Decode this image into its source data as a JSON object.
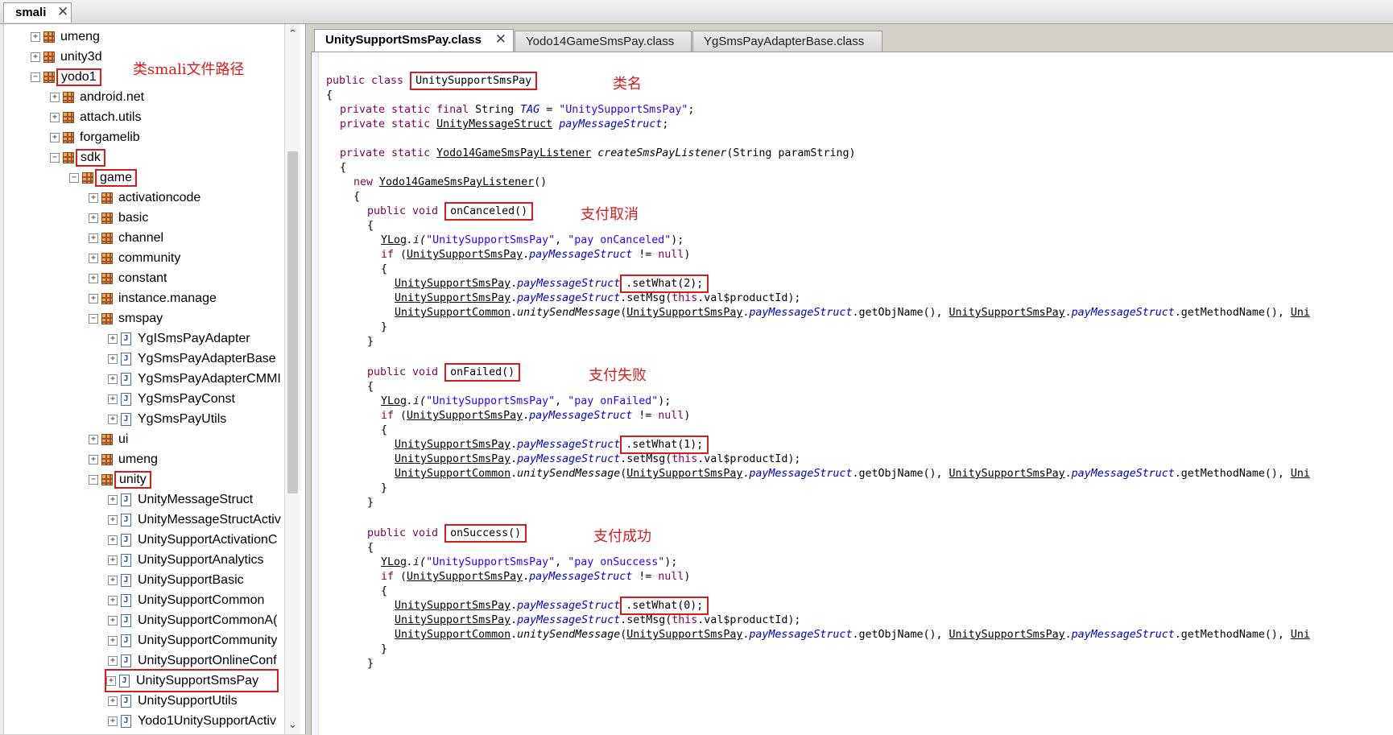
{
  "root_tab": {
    "label": "smali",
    "close": "✕"
  },
  "tree": {
    "annotation": "类smali文件路径",
    "items": [
      {
        "label": "umeng",
        "type": "pkg",
        "depth": 1,
        "expand": "+"
      },
      {
        "label": "unity3d",
        "type": "pkg",
        "depth": 1,
        "expand": "+"
      },
      {
        "label": "yodo1",
        "type": "pkg",
        "depth": 1,
        "expand": "−",
        "boxed": true
      },
      {
        "label": "android.net",
        "type": "pkg",
        "depth": 2,
        "expand": "+"
      },
      {
        "label": "attach.utils",
        "type": "pkg",
        "depth": 2,
        "expand": "+"
      },
      {
        "label": "forgamelib",
        "type": "pkg",
        "depth": 2,
        "expand": "+"
      },
      {
        "label": "sdk",
        "type": "pkg",
        "depth": 2,
        "expand": "−",
        "boxed": true
      },
      {
        "label": "game",
        "type": "pkg",
        "depth": 3,
        "expand": "−",
        "boxed": true
      },
      {
        "label": "activationcode",
        "type": "pkg",
        "depth": 4,
        "expand": "+"
      },
      {
        "label": "basic",
        "type": "pkg",
        "depth": 4,
        "expand": "+"
      },
      {
        "label": "channel",
        "type": "pkg",
        "depth": 4,
        "expand": "+"
      },
      {
        "label": "community",
        "type": "pkg",
        "depth": 4,
        "expand": "+"
      },
      {
        "label": "constant",
        "type": "pkg",
        "depth": 4,
        "expand": "+"
      },
      {
        "label": "instance.manage",
        "type": "pkg",
        "depth": 4,
        "expand": "+"
      },
      {
        "label": "smspay",
        "type": "pkg",
        "depth": 4,
        "expand": "−"
      },
      {
        "label": "YgISmsPayAdapter",
        "type": "cls",
        "depth": 5,
        "expand": "+"
      },
      {
        "label": "YgSmsPayAdapterBase",
        "type": "cls",
        "depth": 5,
        "expand": "+"
      },
      {
        "label": "YgSmsPayAdapterCMMI",
        "type": "cls",
        "depth": 5,
        "expand": "+"
      },
      {
        "label": "YgSmsPayConst",
        "type": "cls",
        "depth": 5,
        "expand": "+"
      },
      {
        "label": "YgSmsPayUtils",
        "type": "cls",
        "depth": 5,
        "expand": "+"
      },
      {
        "label": "ui",
        "type": "pkg",
        "depth": 4,
        "expand": "+"
      },
      {
        "label": "umeng",
        "type": "pkg",
        "depth": 4,
        "expand": "+"
      },
      {
        "label": "unity",
        "type": "pkg",
        "depth": 4,
        "expand": "−",
        "boxed": true
      },
      {
        "label": "UnityMessageStruct",
        "type": "cls",
        "depth": 5,
        "expand": "+"
      },
      {
        "label": "UnityMessageStructActiv",
        "type": "cls",
        "depth": 5,
        "expand": "+"
      },
      {
        "label": "UnitySupportActivationC",
        "type": "cls",
        "depth": 5,
        "expand": "+"
      },
      {
        "label": "UnitySupportAnalytics",
        "type": "cls",
        "depth": 5,
        "expand": "+"
      },
      {
        "label": "UnitySupportBasic",
        "type": "cls",
        "depth": 5,
        "expand": "+"
      },
      {
        "label": "UnitySupportCommon",
        "type": "cls",
        "depth": 5,
        "expand": "+"
      },
      {
        "label": "UnitySupportCommonA(",
        "type": "cls",
        "depth": 5,
        "expand": "+"
      },
      {
        "label": "UnitySupportCommunity",
        "type": "cls",
        "depth": 5,
        "expand": "+"
      },
      {
        "label": "UnitySupportOnlineConf",
        "type": "cls",
        "depth": 5,
        "expand": "+"
      },
      {
        "label": "UnitySupportSmsPay",
        "type": "cls",
        "depth": 5,
        "expand": "+",
        "boxed_full": true
      },
      {
        "label": "UnitySupportUtils",
        "type": "cls",
        "depth": 5,
        "expand": "+"
      },
      {
        "label": "Yodo1UnitySupportActiv",
        "type": "cls",
        "depth": 5,
        "expand": "+"
      }
    ],
    "scroll_up": "⌃",
    "scroll_down": "⌄"
  },
  "editor_tabs": [
    {
      "label": "UnitySupportSmsPay.class",
      "active": true,
      "close": "✕"
    },
    {
      "label": "Yodo14GameSmsPay.class",
      "active": false
    },
    {
      "label": "YgSmsPayAdapterBase.class",
      "active": false
    }
  ],
  "annotations": {
    "class_name": "类名",
    "on_canceled": "支付取消",
    "on_failed": "支付失败",
    "on_success": "支付成功"
  },
  "code": {
    "l1_public_class": "public class ",
    "l1_classname": "UnitySupportSmsPay",
    "l2": "{",
    "l3_mod": "private static final ",
    "l3_type": "String ",
    "l3_field": "TAG",
    "l3_eq": " = ",
    "l3_str": "\"UnitySupportSmsPay\"",
    "l3_end": ";",
    "l4_mod": "private static ",
    "l4_type": "UnityMessageStruct",
    "l4_field": "payMessageStruct",
    "l4_end": ";",
    "l5_mod": "private static ",
    "l5_type": "Yodo14GameSmsPayListener",
    "l5_method": "createSmsPayListener",
    "l5_args": "(String paramString)",
    "l6": "{",
    "l7_new": "new ",
    "l7_type": "Yodo14GameSmsPayListener",
    "l7_end": "()",
    "l8": "{",
    "pub_void": "public void ",
    "m_canceled": "onCanceled()",
    "m_failed": "onFailed()",
    "m_success": "onSuccess()",
    "brace_open": "{",
    "brace_close": "}",
    "ylog": "YLog",
    "ylog_i": ".i(",
    "tag_str": "\"UnitySupportSmsPay\"",
    "comma": ", ",
    "str_canceled": "\"pay onCanceled\"",
    "str_failed": "\"pay onFailed\"",
    "str_success": "\"pay onSuccess\"",
    "close_paren_semi": ");",
    "if_kw": "if ",
    "paren_open": "(",
    "cls_sms": "UnitySupportSmsPay",
    "dot": ".",
    "fld_pms": "payMessageStruct",
    "neq": " != ",
    "null_kw": "null",
    "paren_close": ")",
    "set_what_2": ".setWhat(2);",
    "set_what_1": ".setWhat(1);",
    "set_what_0": ".setWhat(0);",
    "set_msg": ".setMsg(",
    "this_kw": "this",
    "val_prod": ".val$productId",
    "cls_common": "UnitySupportCommon",
    "send_msg": "unitySendMessage",
    "get_obj": ".getObjName(), ",
    "get_method": ".getMethodName(), ",
    "trail": "Uni"
  }
}
